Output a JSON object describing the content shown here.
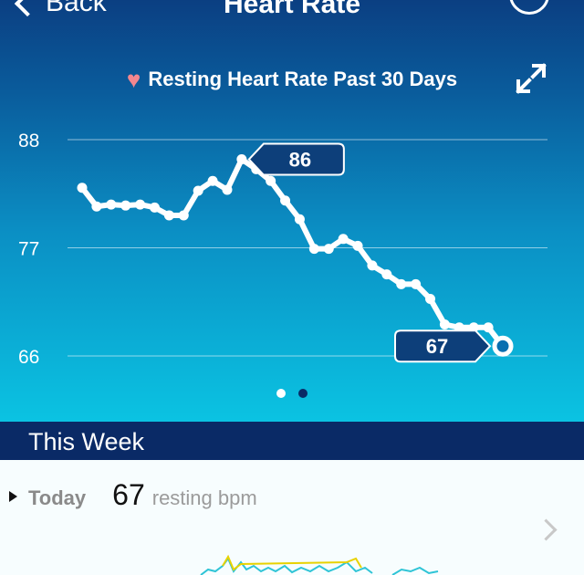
{
  "nav": {
    "back_label": "Back",
    "title": "Heart Rate",
    "action_icon": "circle-action-icon"
  },
  "chart_header": {
    "icon": "heart-icon",
    "title": "Resting Heart Rate Past 30 Days",
    "expand_icon": "expand-icon"
  },
  "colors": {
    "heart": "#f2878f",
    "line": "#ffffff",
    "callout": "#0d3f7a",
    "band": "#0a2a66",
    "sparkline_teal": "#2ec4d6",
    "sparkline_yellow": "#e8d200"
  },
  "chart_data": {
    "type": "line",
    "title": "Resting Heart Rate Past 30 Days",
    "y_ticks": [
      88,
      77,
      66
    ],
    "ylim": [
      66,
      88
    ],
    "grid": true,
    "series": [
      {
        "values": [
          83.1,
          81.2,
          81.4,
          81.3,
          81.4,
          81.1,
          80.3,
          80.3,
          82.8,
          83.8,
          82.9,
          86.0,
          85.0,
          83.8,
          81.8,
          79.9,
          76.9,
          76.9,
          77.9,
          77.2,
          75.2,
          74.3,
          73.3,
          73.3,
          71.8,
          69.2,
          68.9,
          68.9,
          68.9,
          67.0
        ]
      }
    ],
    "annotations": [
      {
        "label": "86",
        "point_index": 11
      },
      {
        "label": "67",
        "point_index": 29
      }
    ]
  },
  "pager": {
    "count": 2,
    "active": 1
  },
  "this_week": {
    "heading": "This Week",
    "day": "Today",
    "value": "67",
    "unit": "resting bpm"
  }
}
